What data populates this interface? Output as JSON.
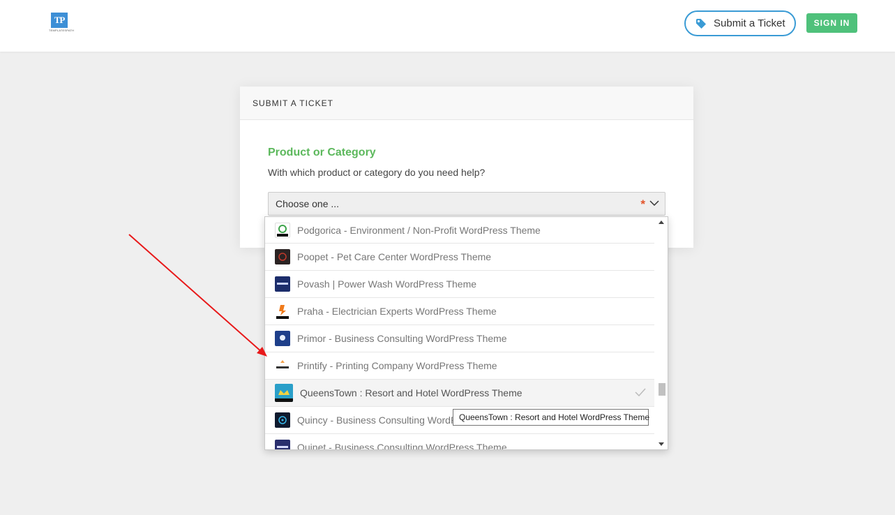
{
  "header": {
    "logo_text": "TP",
    "logo_caption": "TEMPLATESPATH",
    "submit_ticket_label": "Submit a Ticket",
    "sign_in_label": "SIGN IN"
  },
  "card": {
    "title": "SUBMIT A TICKET",
    "field_label": "Product or Category",
    "field_help": "With which product or category do you need help?",
    "select_value": "Choose one ...",
    "required_mark": "*"
  },
  "dropdown": {
    "options": [
      {
        "label": "Podgorica - Environment / Non-Profit WordPress Theme",
        "icon": "podgorica-thumb",
        "color": "#ffffff"
      },
      {
        "label": "Poopet - Pet Care Center WordPress Theme",
        "icon": "poopet-thumb",
        "color": "#2b2323"
      },
      {
        "label": "Povash | Power Wash WordPress Theme",
        "icon": "povash-thumb",
        "color": "#1c2d6b"
      },
      {
        "label": "Praha - Electrician Experts WordPress Theme",
        "icon": "praha-thumb",
        "color": "#ffffff"
      },
      {
        "label": "Primor - Business Consulting WordPress Theme",
        "icon": "primor-thumb",
        "color": "#1e3f8a"
      },
      {
        "label": "Printify - Printing Company WordPress Theme",
        "icon": "printify-thumb",
        "color": "#ffffff"
      },
      {
        "label": "QueensTown : Resort and Hotel WordPress Theme",
        "icon": "queenstown-thumb",
        "color": "#2a9fc9",
        "selected": true
      },
      {
        "label": "Quincy - Business Consulting WordPress Theme",
        "icon": "quincy-thumb",
        "color": "#0f1a2e"
      },
      {
        "label": "Quinet - Business Consulting WordPress Theme",
        "icon": "quinet-thumb",
        "color": "#2a2f6e"
      }
    ]
  },
  "tooltip": "QueensTown : Resort and Hotel WordPress Theme",
  "colors": {
    "accent_green": "#5cb85c",
    "button_green": "#4fc17b",
    "outline_blue": "#3a9bd5",
    "required_red": "#e2542a",
    "annotation_arrow": "#e8191a"
  }
}
